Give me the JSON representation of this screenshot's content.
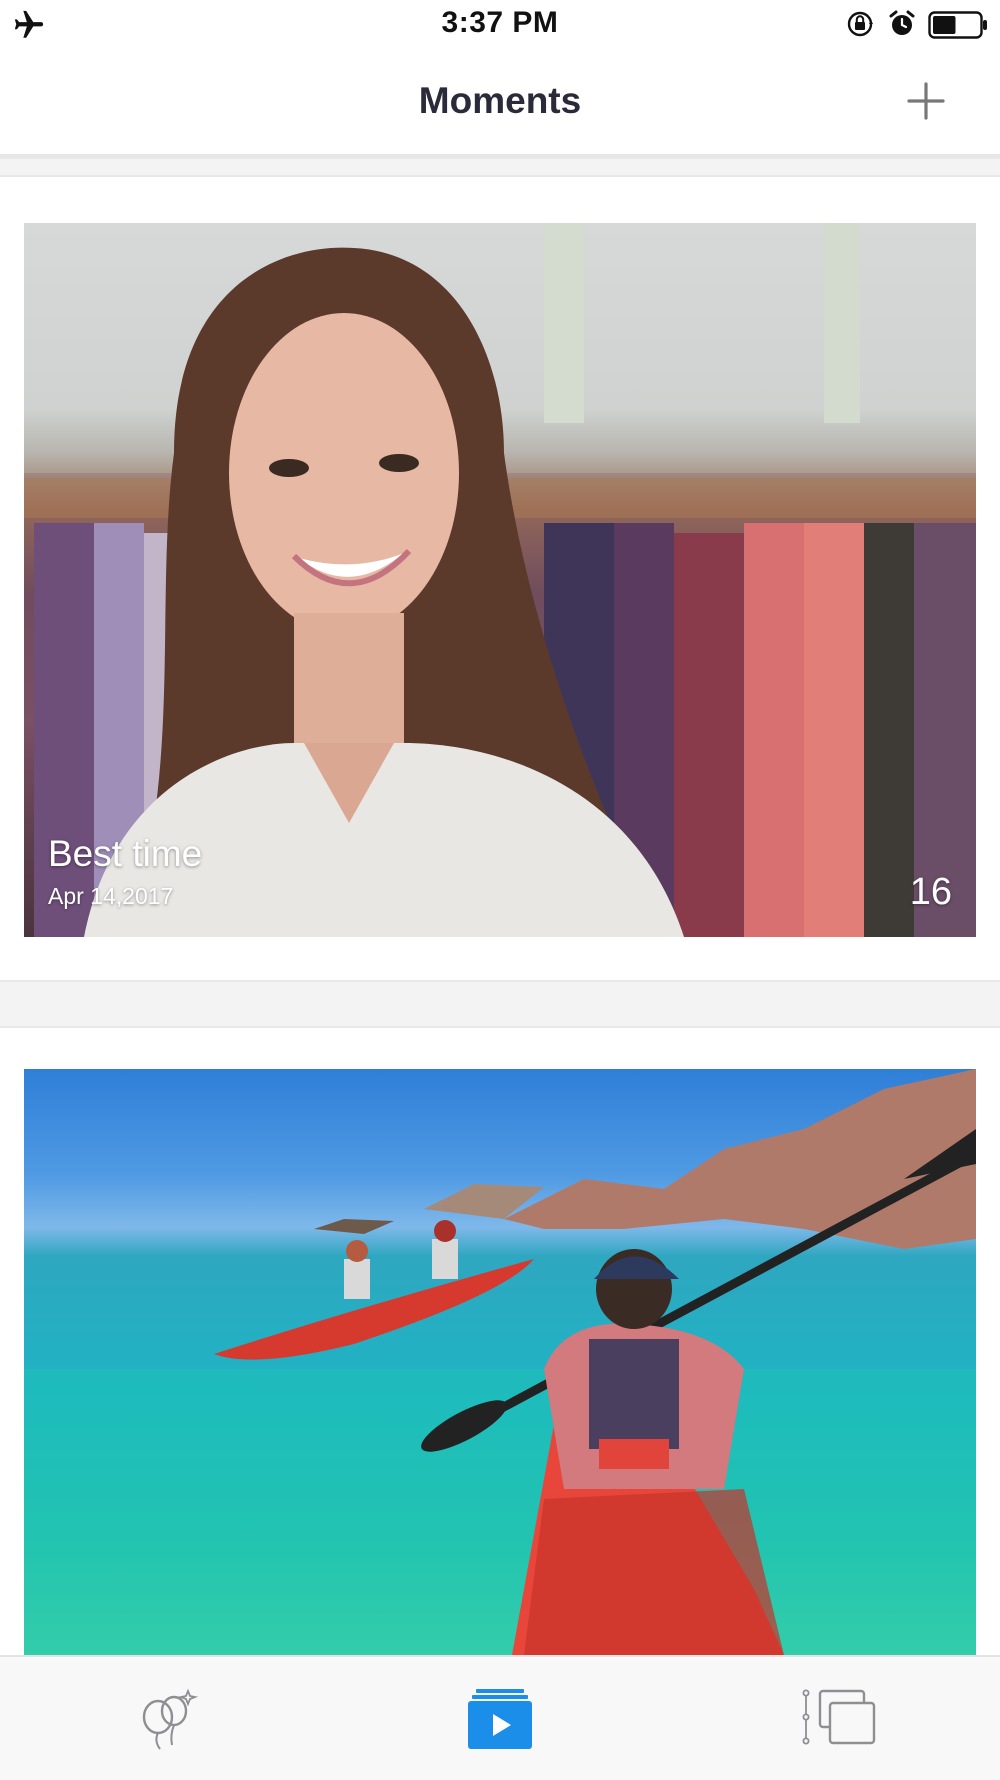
{
  "status_bar": {
    "time": "3:37 PM",
    "icons": [
      "airplane-mode-icon",
      "rotation-lock-icon",
      "alarm-icon",
      "battery-icon"
    ],
    "battery_level": 0.5
  },
  "nav": {
    "title": "Moments",
    "add_icon": "plus-icon"
  },
  "moments": [
    {
      "title": "Best time",
      "date": "Apr 14,2017",
      "count": "16"
    },
    {
      "title": "",
      "date": "",
      "count": ""
    }
  ],
  "tab_bar": {
    "tabs": [
      {
        "icon": "balloons-icon",
        "active": false
      },
      {
        "icon": "play-slideshow-icon",
        "active": true
      },
      {
        "icon": "albums-icon",
        "active": false
      }
    ],
    "active_color": "#1a8ee8",
    "inactive_color": "#8e8e93"
  }
}
